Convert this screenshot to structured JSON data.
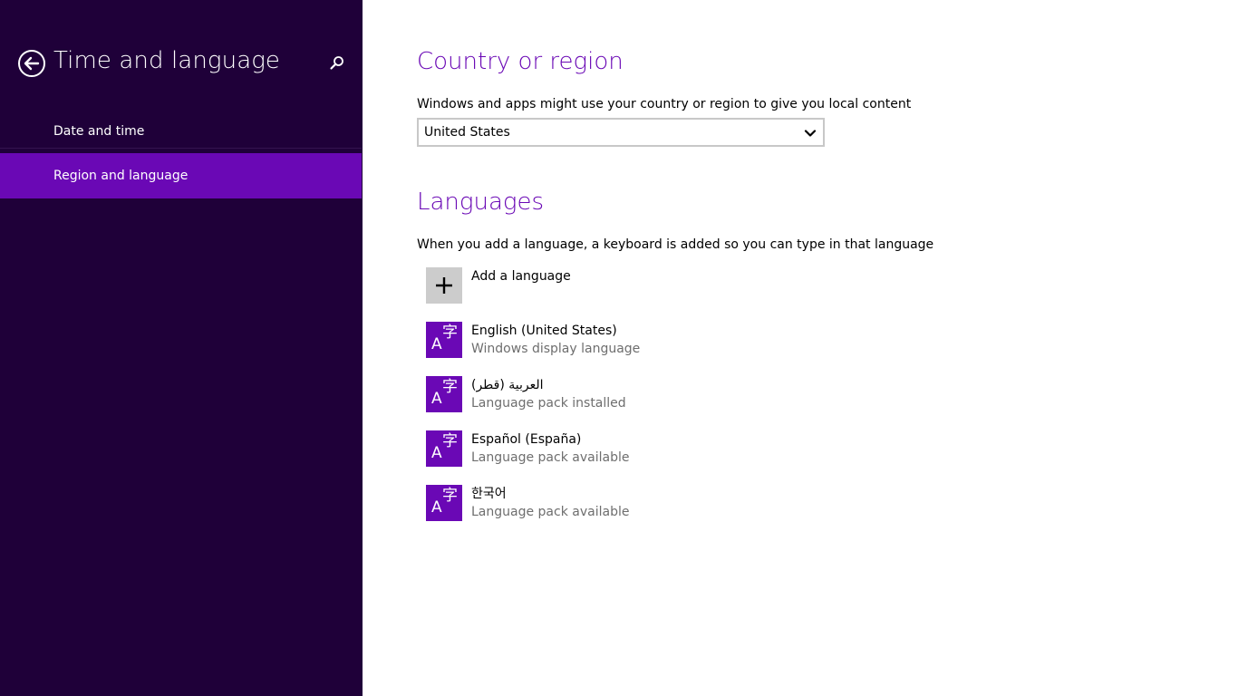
{
  "sidebar": {
    "title": "Time and language",
    "back_icon": "back-arrow-icon",
    "search_icon": "search-icon",
    "items": [
      {
        "label": "Date and time",
        "selected": false
      },
      {
        "label": "Region and language",
        "selected": true
      }
    ]
  },
  "country": {
    "title": "Country or region",
    "description": "Windows and apps might use your country or region to give you local content",
    "selected": "United States"
  },
  "languages": {
    "title": "Languages",
    "description": "When you add a language, a keyboard is added so you can type in that language",
    "add_label": "Add a language",
    "items": [
      {
        "name": "English (United States)",
        "status": "Windows display language"
      },
      {
        "name": "العربية (قطر)",
        "status": "Language pack installed"
      },
      {
        "name": "Español (España)",
        "status": "Language pack available"
      },
      {
        "name": "한국어",
        "status": "Language pack available"
      }
    ]
  },
  "colors": {
    "sidebar_bg": "#1f0039",
    "accent": "#6a08b5",
    "secondary_text": "#6e6e6e"
  }
}
